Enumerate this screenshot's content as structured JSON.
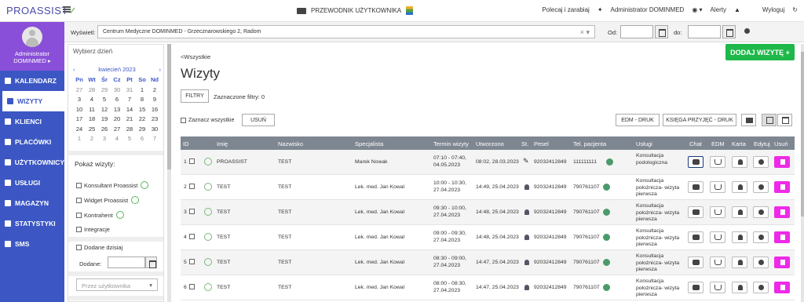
{
  "topbar": {
    "logo_main": "PROASSIST",
    "guide_label": "PRZEWODNIK UŻYTKOWNIKA",
    "recommend_label": "Polecaj i zarabiaj",
    "user_label": "Administrator DOMINMED",
    "alerts_label": "Alerty",
    "logout_label": "Wyloguj"
  },
  "profile": {
    "name": "Administrator",
    "org": "DOMINMED ▸"
  },
  "sidebar": {
    "items": [
      {
        "label": "KALENDARZ",
        "active": false
      },
      {
        "label": "WIZYTY",
        "active": true
      },
      {
        "label": "KLIENCI",
        "active": false
      },
      {
        "label": "PLACÓWKI",
        "active": false
      },
      {
        "label": "UŻYTKOWNICY",
        "active": false
      },
      {
        "label": "USŁUGI",
        "active": false
      },
      {
        "label": "MAGAZYN",
        "active": false
      },
      {
        "label": "STATYSTYKI",
        "active": false
      },
      {
        "label": "SMS",
        "active": false
      }
    ]
  },
  "filterbar": {
    "display_label": "Wyświetl:",
    "selected_clinic": "Centrum Medyczne DOMINMED - Grzecznarowskiego 2, Radom",
    "clear_symbols": "× ▾",
    "from_label": "Od:",
    "to_label": "do:"
  },
  "left_panel": {
    "choose_day_title": "Wybierz dzień",
    "calendar": {
      "month_label": "kwiecień 2023",
      "prev": "‹",
      "next": "›",
      "weekdays": [
        "Pn",
        "Wt",
        "Śr",
        "Cz",
        "Pt",
        "So",
        "Nd"
      ],
      "weeks": [
        [
          "27",
          "28",
          "29",
          "30",
          "31",
          "1",
          "2"
        ],
        [
          "3",
          "4",
          "5",
          "6",
          "7",
          "8",
          "9"
        ],
        [
          "10",
          "11",
          "12",
          "13",
          "14",
          "15",
          "16"
        ],
        [
          "17",
          "18",
          "19",
          "20",
          "21",
          "22",
          "23"
        ],
        [
          "24",
          "25",
          "26",
          "27",
          "28",
          "29",
          "30"
        ],
        [
          "1",
          "2",
          "3",
          "4",
          "5",
          "6",
          "7"
        ]
      ]
    },
    "show_visits_title": "Pokaż wizyty:",
    "options": [
      "Konsultant Proassist",
      "Widget Proassist",
      "Kontrahent",
      "Integracje"
    ],
    "added_today_label": "Dodane dzisiaj",
    "added_label": "Dodane:",
    "by_user_placeholder": "Przez użytkownika"
  },
  "main": {
    "back_link": "<Wszystkie",
    "page_title": "Wizyty",
    "add_visit_button": "DODAJ WIZYTĘ +",
    "filters_button": "FILTRY",
    "selected_filters": "Zaznaczone filtry: 0",
    "select_all_label": "Zaznacz wszystkie",
    "delete_button": "USUŃ",
    "edm_print_button": "EDM - DRUK",
    "book_print_button": "KSIĘGA PRZYJĘĆ - DRUK"
  },
  "table": {
    "columns": [
      "ID",
      "Imię",
      "Nazwisko",
      "Specjalista",
      "Termin wizyty",
      "Utworzono",
      "St.",
      "Pesel",
      "Tel. pacjenta",
      "Usługi",
      "Chat",
      "EDM",
      "Karta",
      "Edytuj",
      "Usuń"
    ],
    "rows": [
      {
        "id": "1",
        "first": "PROASSIST",
        "last": "TEST",
        "spec": "Marek Nowak",
        "term": "07:10 - 07:40, 04.05.2023",
        "created": "08:02, 28.03.2023",
        "pesel": "92032412849",
        "phone": "111111111",
        "service": "Konsultacja podologiczna"
      },
      {
        "id": "2",
        "first": "TEST",
        "last": "TEST",
        "spec": "Lek. med. Jan Kowal",
        "term": "10:00 - 10:30, 27.04.2023",
        "created": "14:49, 25.04.2023",
        "pesel": "92032412849",
        "phone": "790761107",
        "service": "Konsultacja położnicza- wizyta pierwsza"
      },
      {
        "id": "3",
        "first": "TEST",
        "last": "TEST",
        "spec": "Lek. med. Jan Kowal",
        "term": "09:30 - 10:00, 27.04.2023",
        "created": "14:48, 25.04.2023",
        "pesel": "92032412849",
        "phone": "790761107",
        "service": "Konsultacja położnicza- wizyta pierwsza"
      },
      {
        "id": "4",
        "first": "TEST",
        "last": "TEST",
        "spec": "Lek. med. Jan Kowal",
        "term": "09:00 - 09:30, 27.04.2023",
        "created": "14:48, 25.04.2023",
        "pesel": "92032412849",
        "phone": "790761107",
        "service": "Konsultacja położnicza- wizyta pierwsza"
      },
      {
        "id": "5",
        "first": "TEST",
        "last": "TEST",
        "spec": "Lek. med. Jan Kowal",
        "term": "08:30 - 09:00, 27.04.2023",
        "created": "14:47, 25.04.2023",
        "pesel": "92032412849",
        "phone": "790761107",
        "service": "Konsultacja położnicza- wizyta pierwsza"
      },
      {
        "id": "6",
        "first": "TEST",
        "last": "TEST",
        "spec": "Lek. med. Jan Kowal",
        "term": "08:00 - 08:30, 27.04.2023",
        "created": "14:47, 25.04.2023",
        "pesel": "92032412849",
        "phone": "790761107",
        "service": "Konsultacja położnicza- wizyta pierwsza"
      }
    ]
  },
  "colors": {
    "sidebar": "#3c57c4",
    "profile": "#8a4fd8",
    "add_button": "#1fb84a",
    "delete_action": "#ee2ae8",
    "table_header": "#7e8791"
  }
}
